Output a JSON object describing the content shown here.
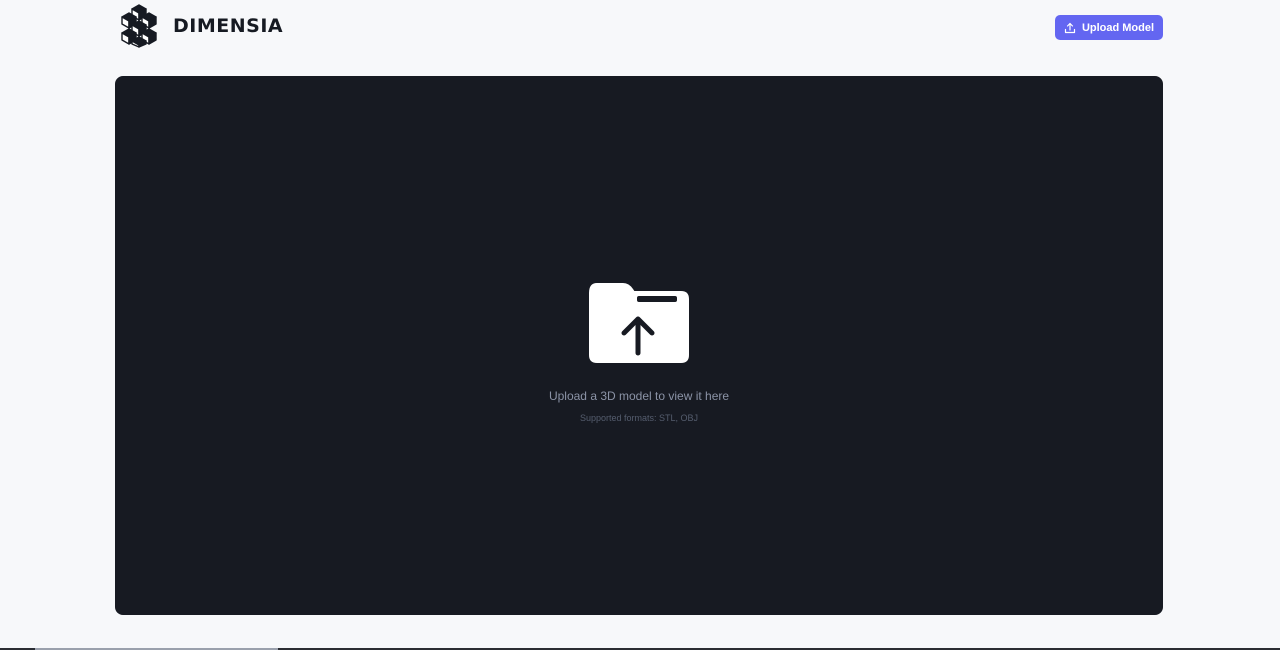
{
  "app": {
    "name": "DIMENSIA",
    "logo_icon": "cube-cluster-logo"
  },
  "header": {
    "upload_button_label": "Upload Model",
    "upload_button_icon": "upload-icon",
    "accent_color": "#6366f1"
  },
  "viewer": {
    "background_color": "#171a22",
    "empty_state": {
      "icon": "folder-upload-icon",
      "title": "Upload a 3D model to view it here",
      "subtitle": "Supported formats: STL, OBJ"
    }
  }
}
